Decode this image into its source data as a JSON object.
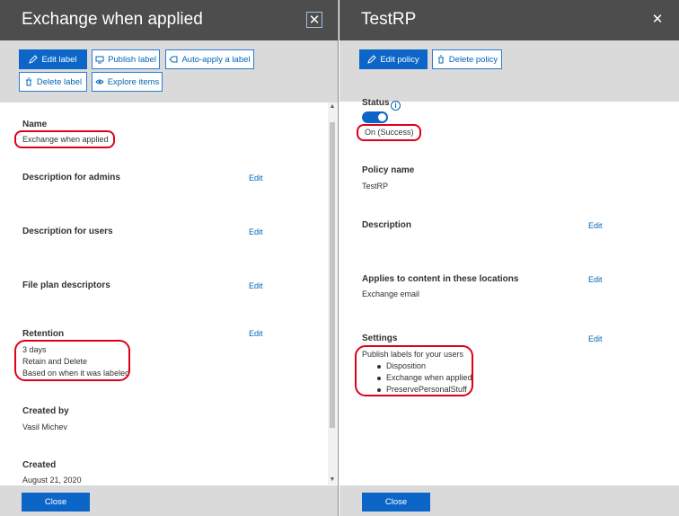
{
  "panel_a": {
    "title": "Exchange when applied",
    "close_glyph": "✕",
    "toolbar": {
      "edit_label": "Edit label",
      "publish_label": "Publish label",
      "auto_apply": "Auto-apply a label",
      "delete_label": "Delete label",
      "explore_items": "Explore items"
    },
    "name": {
      "label": "Name",
      "value": "Exchange when applied"
    },
    "description_admins": {
      "label": "Description for admins",
      "edit": "Edit"
    },
    "description_users": {
      "label": "Description for users",
      "edit": "Edit"
    },
    "file_plan": {
      "label": "File plan descriptors",
      "edit": "Edit"
    },
    "retention": {
      "label": "Retention",
      "edit": "Edit",
      "lines": [
        "3 days",
        "Retain and Delete",
        "Based on when it was labeled"
      ]
    },
    "created_by": {
      "label": "Created by",
      "value": "Vasil Michev"
    },
    "created": {
      "label": "Created",
      "value": "August 21, 2020"
    },
    "footer": {
      "close": "Close"
    }
  },
  "panel_b": {
    "title": "TestRP",
    "close_glyph": "✕",
    "toolbar": {
      "edit_policy": "Edit policy",
      "delete_policy": "Delete policy"
    },
    "status": {
      "label": "Status",
      "info_glyph": "i",
      "toggle_on": true,
      "value": "On (Success)"
    },
    "policy_name": {
      "label": "Policy name",
      "value": "TestRP"
    },
    "description": {
      "label": "Description",
      "edit": "Edit"
    },
    "applies_to": {
      "label": "Applies to content in these locations",
      "edit": "Edit",
      "value": "Exchange email"
    },
    "settings": {
      "label": "Settings",
      "edit": "Edit",
      "intro": "Publish labels for your users",
      "items": [
        "Disposition",
        "Exchange when applied",
        "PreservePersonalStuff"
      ]
    },
    "footer": {
      "close": "Close"
    }
  },
  "colors": {
    "header_bg": "#4d4d4d",
    "toolbar_bg": "#dadada",
    "accent": "#0b66c8",
    "link": "#0067b8",
    "annotation": "#e0001b"
  },
  "icons": {
    "edit": "pencil-icon",
    "publish": "publish-icon",
    "auto_apply": "tag-icon",
    "delete": "trash-icon",
    "explore": "eye-icon",
    "close": "close-icon",
    "info": "info-icon"
  }
}
